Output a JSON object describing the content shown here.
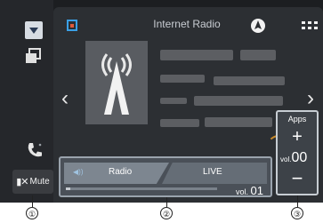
{
  "header": {
    "title": "Internet Radio"
  },
  "sidebar": {
    "mute_label": "Mute"
  },
  "source": {
    "left_label": "Radio",
    "right_label": "LIVE",
    "volume_prefix": "vol.",
    "volume_value": "01",
    "progress_fraction": 0.03
  },
  "apps_panel": {
    "label": "Apps",
    "plus": "+",
    "volume_prefix": "vol.",
    "volume_value": "00",
    "minus": "−"
  },
  "nav": {
    "prev": "‹",
    "next": "›"
  },
  "callouts": [
    "①",
    "②",
    "③"
  ],
  "colors": {
    "accent_ring": "#c88a2a",
    "app_icon": "#3aa0e6"
  }
}
